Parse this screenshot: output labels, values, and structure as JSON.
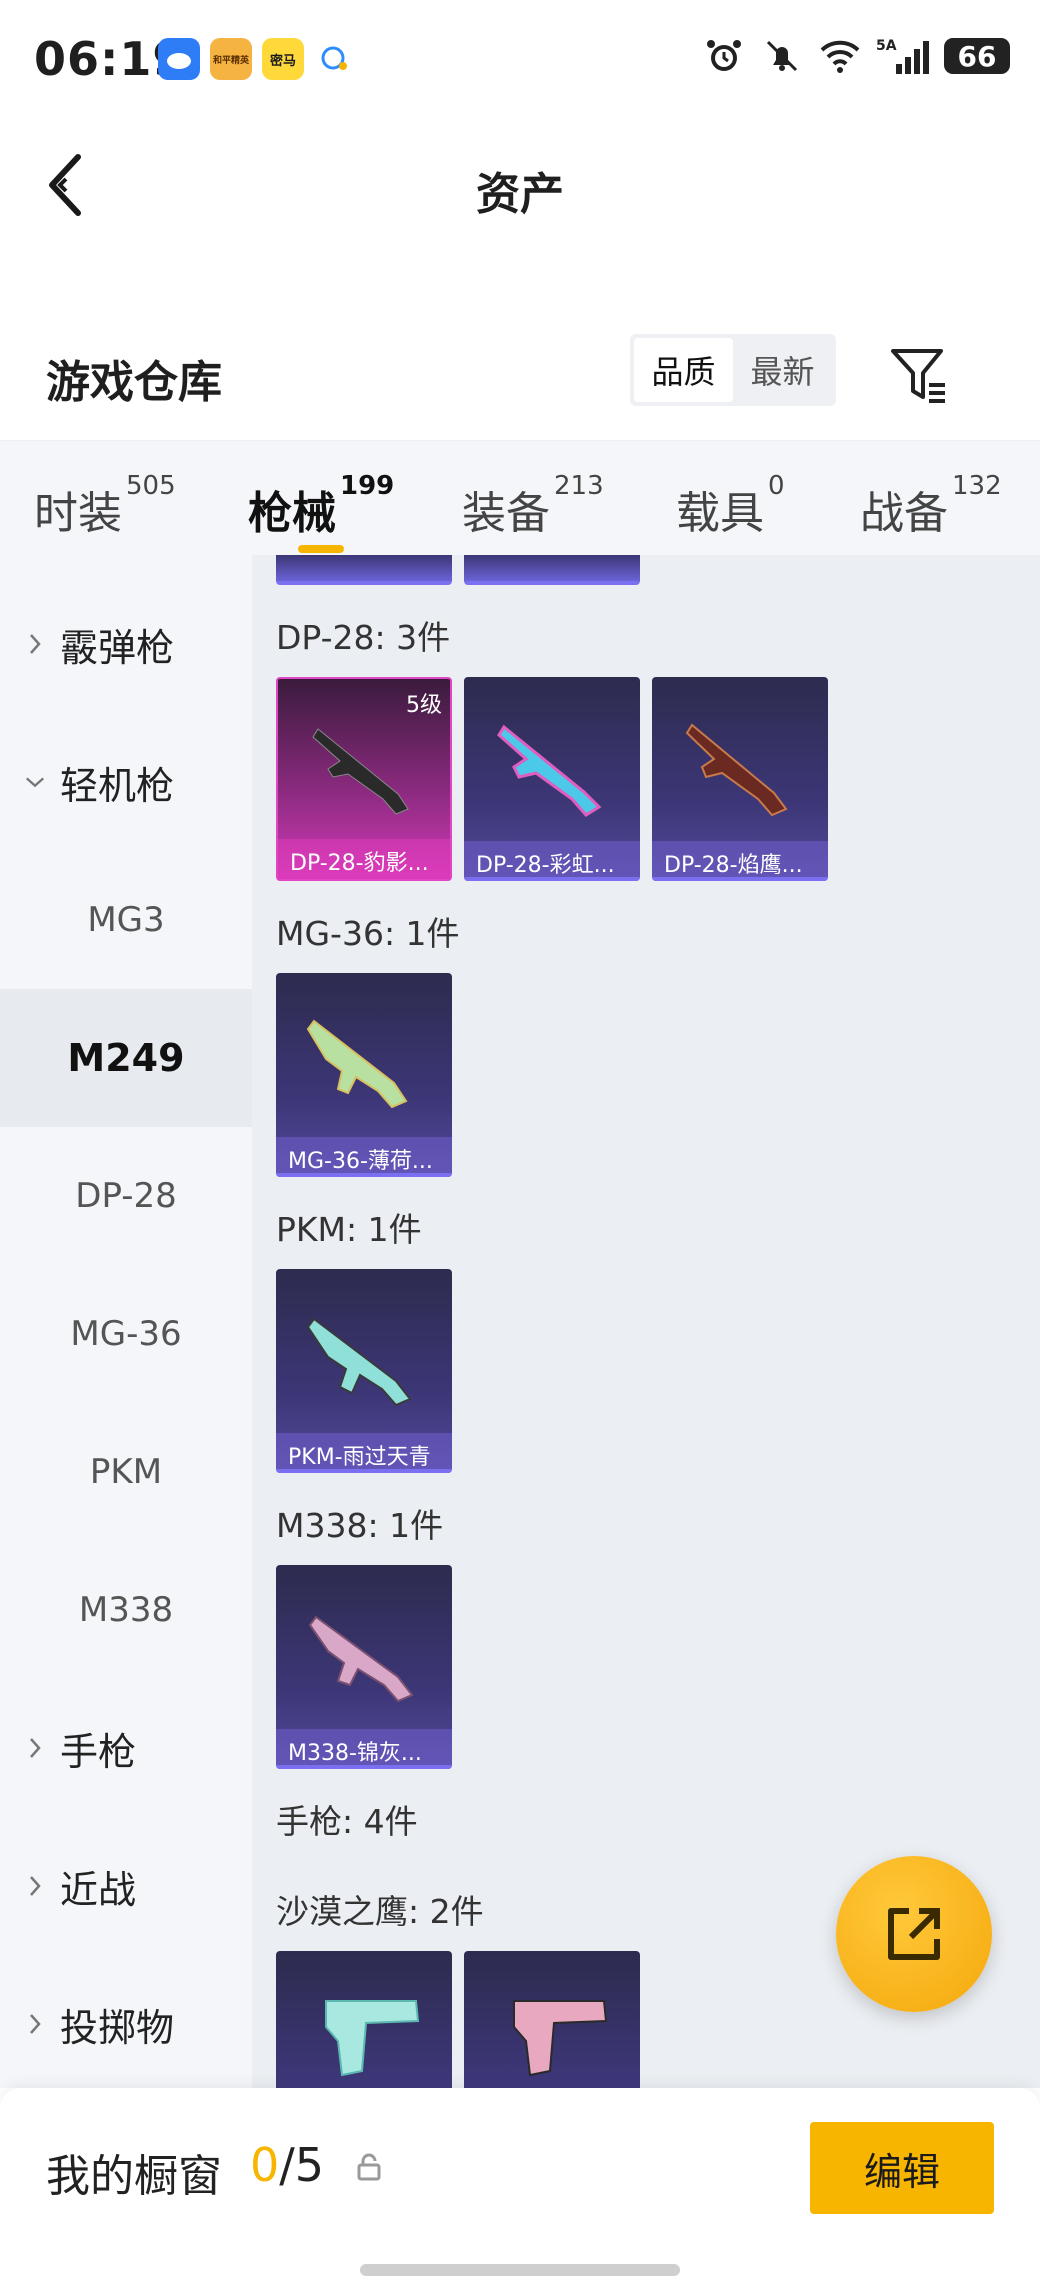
{
  "status_bar": {
    "time": "06:19",
    "app_icons": [
      "weather-app-icon",
      "game-app-icon",
      "password-app-icon",
      "chat-app-icon"
    ],
    "app_icon_texts": [
      "",
      "和平精英",
      "密马",
      ""
    ],
    "network": "5A",
    "battery": "66"
  },
  "nav": {
    "title": "资产"
  },
  "warehouse": {
    "title": "游戏仓库",
    "sort_options": [
      "品质",
      "最新"
    ],
    "sort_selected": "品质"
  },
  "tabs": [
    {
      "label": "时装",
      "count": "505"
    },
    {
      "label": "枪械",
      "count": "199"
    },
    {
      "label": "装备",
      "count": "213"
    },
    {
      "label": "载具",
      "count": "0"
    },
    {
      "label": "战备",
      "count": "132"
    }
  ],
  "active_tab": "枪械",
  "sidebar": {
    "items": [
      {
        "label": "霰弹枪",
        "type": "group"
      },
      {
        "label": "轻机枪",
        "type": "group"
      },
      {
        "label": "MG3",
        "type": "sub"
      },
      {
        "label": "M249",
        "type": "sub"
      },
      {
        "label": "DP-28",
        "type": "sub"
      },
      {
        "label": "MG-36",
        "type": "sub"
      },
      {
        "label": "PKM",
        "type": "sub"
      },
      {
        "label": "M338",
        "type": "sub"
      },
      {
        "label": "手枪",
        "type": "group"
      },
      {
        "label": "近战",
        "type": "group"
      },
      {
        "label": "投掷物",
        "type": "group"
      }
    ],
    "selected": "M249"
  },
  "sections": [
    {
      "label": "DP-28: 3件",
      "items": [
        {
          "name": "DP-28-豹影...",
          "level": "5级",
          "rarity": "pink"
        },
        {
          "name": "DP-28-彩虹...",
          "level": "",
          "rarity": "purple"
        },
        {
          "name": "DP-28-焰鹰...",
          "level": "",
          "rarity": "purple"
        }
      ]
    },
    {
      "label": "MG-36: 1件",
      "items": [
        {
          "name": "MG-36-薄荷...",
          "level": "",
          "rarity": "purple"
        }
      ]
    },
    {
      "label": "PKM: 1件",
      "items": [
        {
          "name": "PKM-雨过天青",
          "level": "",
          "rarity": "purple"
        }
      ]
    },
    {
      "label": "M338: 1件",
      "items": [
        {
          "name": "M338-锦灰...",
          "level": "",
          "rarity": "purple"
        }
      ]
    },
    {
      "label": "手枪: 4件",
      "items": []
    },
    {
      "label": "沙漠之鹰: 2件",
      "items": [
        {
          "name": "",
          "level": "",
          "rarity": "purple"
        },
        {
          "name": "",
          "level": "",
          "rarity": "purple"
        }
      ]
    }
  ],
  "showcase": {
    "label": "我的橱窗",
    "current": "0",
    "separator": "/",
    "max": "5",
    "edit_label": "编辑"
  },
  "colors": {
    "accent": "#f8b500",
    "card_purple": "#3c3676",
    "card_pink": "#d13bb8"
  }
}
